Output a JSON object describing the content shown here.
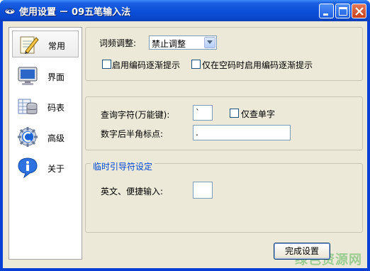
{
  "window": {
    "title": "使用设置 － 09五笔输入法"
  },
  "sidebar": {
    "items": [
      {
        "label": "常用",
        "icon": "notepad-pencil-icon",
        "active": true
      },
      {
        "label": "界面",
        "icon": "monitor-icon",
        "active": false
      },
      {
        "label": "码表",
        "icon": "database-table-icon",
        "active": false
      },
      {
        "label": "高级",
        "icon": "gear-icon",
        "active": false
      },
      {
        "label": "关于",
        "icon": "info-icon",
        "active": false
      }
    ]
  },
  "general": {
    "freq_label": "词频调整:",
    "freq_value": "禁止调整",
    "hint_checkbox": "启用编码逐渐提示",
    "hint_space_checkbox": "仅在空码时启用编码逐渐提示"
  },
  "query": {
    "query_label": "查询字符(万能键):",
    "query_value": "`",
    "single_char_checkbox": "仅查单字",
    "punct_label": "数字后半角标点:",
    "punct_value": "."
  },
  "guide": {
    "legend": "临时引导符设定",
    "english_label": "英文、便捷输入:",
    "english_value": ""
  },
  "footer": {
    "done_button": "完成设置",
    "watermark": "绿色资源网"
  },
  "colors": {
    "titlebar": "#0a4fd8",
    "face": "#ece9d8",
    "legend_text": "#0046d5"
  }
}
